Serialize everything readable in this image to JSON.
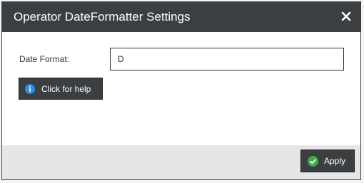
{
  "dialog": {
    "title": "Operator DateFormatter Settings",
    "close_icon": "close-icon"
  },
  "form": {
    "date_format_label": "Date Format:",
    "date_format_value": "D"
  },
  "help": {
    "label": "Click for help",
    "icon": "info-icon"
  },
  "footer": {
    "apply_label": "Apply",
    "apply_icon": "check-circle-icon"
  },
  "colors": {
    "titlebar": "#3c3f41",
    "button": "#3c3f41",
    "info_icon": "#2d8fe0",
    "apply_icon": "#3fae49",
    "footer": "#e6e6e6"
  }
}
